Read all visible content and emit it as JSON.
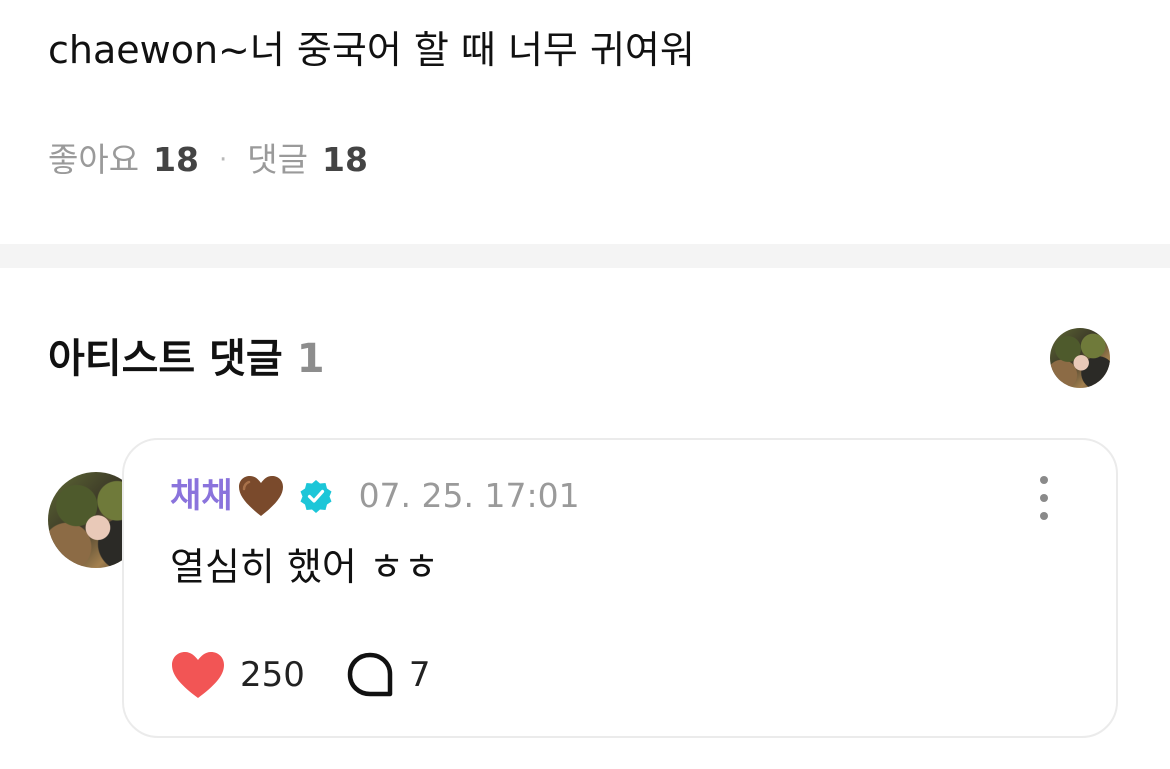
{
  "post": {
    "text": "chaewon~너 중국어 할 때 너무 귀여워",
    "likes_label": "좋아요",
    "likes_count": "18",
    "separator": "·",
    "comments_label": "댓글",
    "comments_count": "18"
  },
  "artist_comments": {
    "title": "아티스트 댓글",
    "count": "1"
  },
  "comment": {
    "author": "채채",
    "author_emoji": "brown-heart-icon",
    "verified_icon": "verified-badge-icon",
    "timestamp": "07. 25. 17:01",
    "text": "열심히 했어 ㅎㅎ",
    "like_count": "250",
    "reply_count": "7"
  },
  "colors": {
    "author_name": "#8a73dc",
    "like_heart": "#f25555",
    "verified_badge": "#1cc6d8",
    "brown_heart": "#7a4a2c",
    "divider": "#f4f4f4",
    "card_border": "#ebebeb"
  }
}
